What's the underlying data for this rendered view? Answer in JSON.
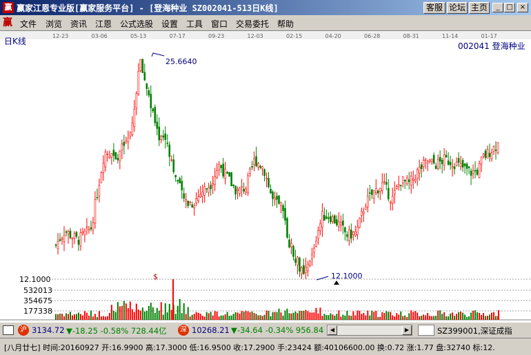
{
  "window": {
    "title": "赢家江恩专业版[赢家服务平台] - [登海种业  SZ002041-513日K线]",
    "app_icon": "赢",
    "buttons": [
      "客服",
      "论坛",
      "主页"
    ],
    "win_controls": [
      "_",
      "□",
      "×"
    ]
  },
  "menu": {
    "logo": "赢",
    "items": [
      "文件",
      "浏览",
      "资讯",
      "江恩",
      "公式选股",
      "设置",
      "工具",
      "窗口",
      "交易委托",
      "帮助"
    ]
  },
  "chart_header": {
    "left_label": "日K线",
    "stock_label": "002041  登海种业",
    "date_ticks": [
      "12-23",
      "03-06",
      "05-13",
      "07-17",
      "09-23",
      "12-03",
      "02-15",
      "04-20",
      "06-28",
      "08-31",
      "11-14",
      "01-17"
    ]
  },
  "chart_data": {
    "type": "candlestick",
    "price_labels": [
      "12.1000"
    ],
    "max_annotation": "25.6640",
    "min_annotation": "12.1000",
    "volume_labels": [
      "532013",
      "354675",
      "177338"
    ],
    "dividend_marker": "$",
    "colors": {
      "up": "#ff0000",
      "down": "#008000",
      "grid": "#808080",
      "annot": "#000080"
    }
  },
  "status1": {
    "sh_badge": "沪",
    "sh_index": "3134.72",
    "sh_change": "▼-18.25 -0.58% 728.44亿",
    "sz_badge": "深",
    "sz_index": "10268.21",
    "sz_change": "▼-34.64 -0.34% 956.84",
    "code_input": "SZ399001,深证成指"
  },
  "status2": {
    "text": "[八月廿七] 时间:20160927 开:16.9900 高:17.3000 低:16.9500 收:17.2900 手:23424 额:40106600.00 换:0.72 涨:1.77 盘:32740 标:12."
  }
}
